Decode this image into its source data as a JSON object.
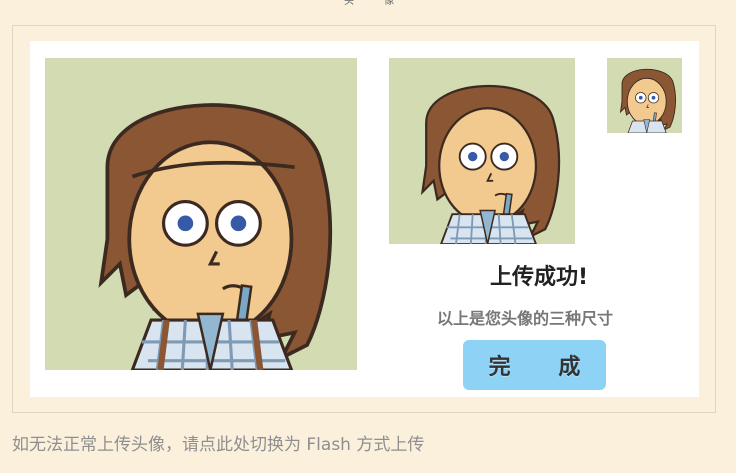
{
  "top_text": "头像",
  "status": {
    "title": "上传成功!",
    "subtitle": "以上是您头像的三种尺寸"
  },
  "buttons": {
    "done_label": "完 成"
  },
  "footer": {
    "switch_text": "如无法正常上传头像，请点此处切换为 Flash 方式上传"
  },
  "colors": {
    "page_background": "#faf0dc",
    "panel_background": "#ffffff",
    "avatar_background": "#d2dbb1",
    "button_background": "#8ed3f6",
    "button_text": "#333333",
    "muted_text": "#8f8f8f"
  },
  "avatar_sizes": [
    {
      "name": "large"
    },
    {
      "name": "medium"
    },
    {
      "name": "small"
    }
  ]
}
